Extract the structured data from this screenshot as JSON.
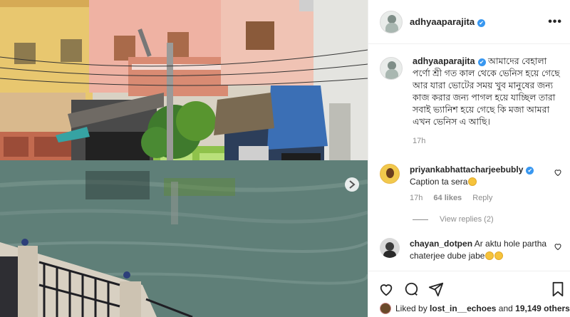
{
  "post": {
    "author": "adhyaaparajita",
    "verified_mark": "✔",
    "more_icon": "•••"
  },
  "caption": {
    "author": "adhyaaparajita",
    "text": "আমাদের বেহালা পর্ণো শ্রী গত কাল থেকে ভেনিস হয়ে গেছে আর যারা ভোটের সময় খুব মানুষের জন্য কাজ করার জন্য পাগল হয়ে যাচ্ছিল তারা সবাই ভ্যানিশ হয়ে গেছে কি মজা আমরা এখন ভেনিস এ আছি।",
    "time": "17h"
  },
  "comments": [
    {
      "user": "priyankabhattacharjeebubly",
      "text": "Caption ta sera",
      "time": "17h",
      "likes": "64 likes",
      "reply": "Reply",
      "view_replies": "View replies (2)"
    },
    {
      "user": "chayan_dotpen",
      "text": "Ar aktu hole partha chaterjee dube jabe"
    }
  ],
  "footer": {
    "liked_prefix": "Liked by",
    "liked_user": "lost_in__echoes",
    "liked_and": "and",
    "liked_count": "19,149 others"
  },
  "colors": {
    "verified": "#3897f0",
    "water": "#5f7f78",
    "text": "#262626",
    "muted": "#8e8e8e"
  },
  "icons": [
    "heart-icon",
    "comment-icon",
    "share-icon",
    "bookmark-icon",
    "more-icon"
  ]
}
